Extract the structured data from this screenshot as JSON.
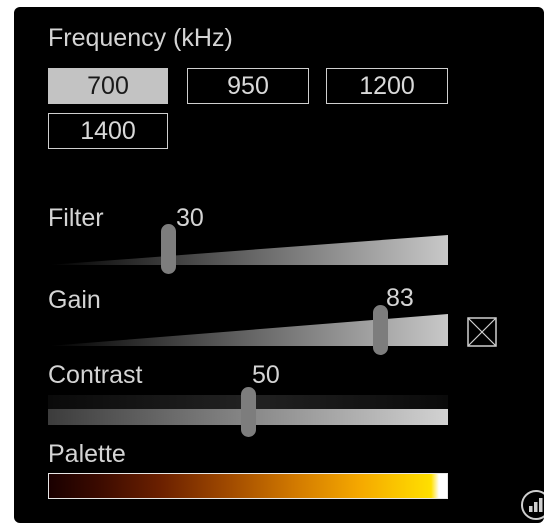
{
  "frequency": {
    "label": "Frequency (kHz)",
    "options": [
      "700",
      "950",
      "1200",
      "1400"
    ],
    "selected": "700"
  },
  "filter": {
    "label": "Filter",
    "value": "30",
    "level": 0.3
  },
  "gain": {
    "label": "Gain",
    "value": "83",
    "level": 0.83,
    "checkbox_checked": true
  },
  "contrast": {
    "label": "Contrast",
    "value": "50",
    "level": 0.5
  },
  "palette": {
    "label": "Palette"
  },
  "icons": {
    "checkbox": "checkbox-x-icon",
    "stats": "bar-chart-icon"
  },
  "colors": {
    "background": "#000000",
    "text": "#d4d4d4",
    "selected_button": "#c3c3c3"
  }
}
